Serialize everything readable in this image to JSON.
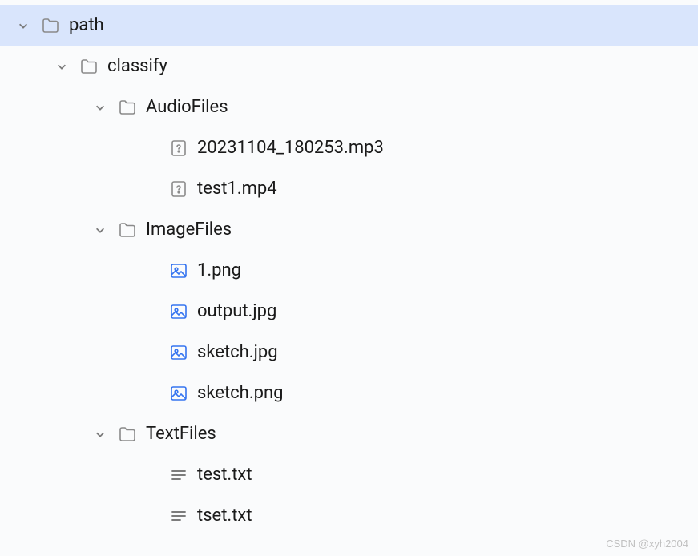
{
  "tree": {
    "root": {
      "name": "path",
      "type": "folder",
      "expanded": true,
      "selected": true,
      "children": [
        {
          "name": "classify",
          "type": "folder",
          "expanded": true,
          "children": [
            {
              "name": "AudioFiles",
              "type": "folder",
              "expanded": true,
              "children": [
                {
                  "name": "20231104_180253.mp3",
                  "type": "unknown"
                },
                {
                  "name": "test1.mp4",
                  "type": "unknown"
                }
              ]
            },
            {
              "name": "ImageFiles",
              "type": "folder",
              "expanded": true,
              "children": [
                {
                  "name": "1.png",
                  "type": "image"
                },
                {
                  "name": "output.jpg",
                  "type": "image"
                },
                {
                  "name": "sketch.jpg",
                  "type": "image"
                },
                {
                  "name": "sketch.png",
                  "type": "image"
                }
              ]
            },
            {
              "name": "TextFiles",
              "type": "folder",
              "expanded": true,
              "children": [
                {
                  "name": "test.txt",
                  "type": "text"
                },
                {
                  "name": "tset.txt",
                  "type": "text"
                }
              ]
            }
          ]
        }
      ]
    }
  },
  "watermark": "CSDN @xyh2004"
}
